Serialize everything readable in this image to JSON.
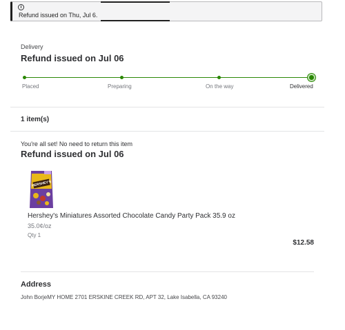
{
  "alert": {
    "icon": "info-icon",
    "message": "Refund issued on Thu, Jul 6."
  },
  "order": {
    "delivery_label": "Delivery",
    "status_title": "Refund issued on Jul 06",
    "tracker": {
      "steps": [
        "Placed",
        "Preparing",
        "On the way",
        "Delivered"
      ],
      "current_step": 4
    }
  },
  "items": {
    "count_label": "1 item(s)",
    "return_note": "You're all set! No need to return this item",
    "status_title": "Refund issued on Jul 06",
    "list": [
      {
        "name": "Hershey's Miniatures Assorted Chocolate Candy Party Pack 35.9 oz",
        "unit_price": "35.0¢/oz",
        "qty": "Qty 1",
        "price": "$12.58",
        "image_icon": "candy-bag-image"
      }
    ]
  },
  "address": {
    "title": "Address",
    "text": "John BorjeMY HOME 2701 ERSKINE CREEK RD, APT 32, Lake Isabella, CA 93240"
  },
  "colors": {
    "accent_green": "#2a8703",
    "text": "#2e2f32",
    "muted": "#74767c"
  }
}
